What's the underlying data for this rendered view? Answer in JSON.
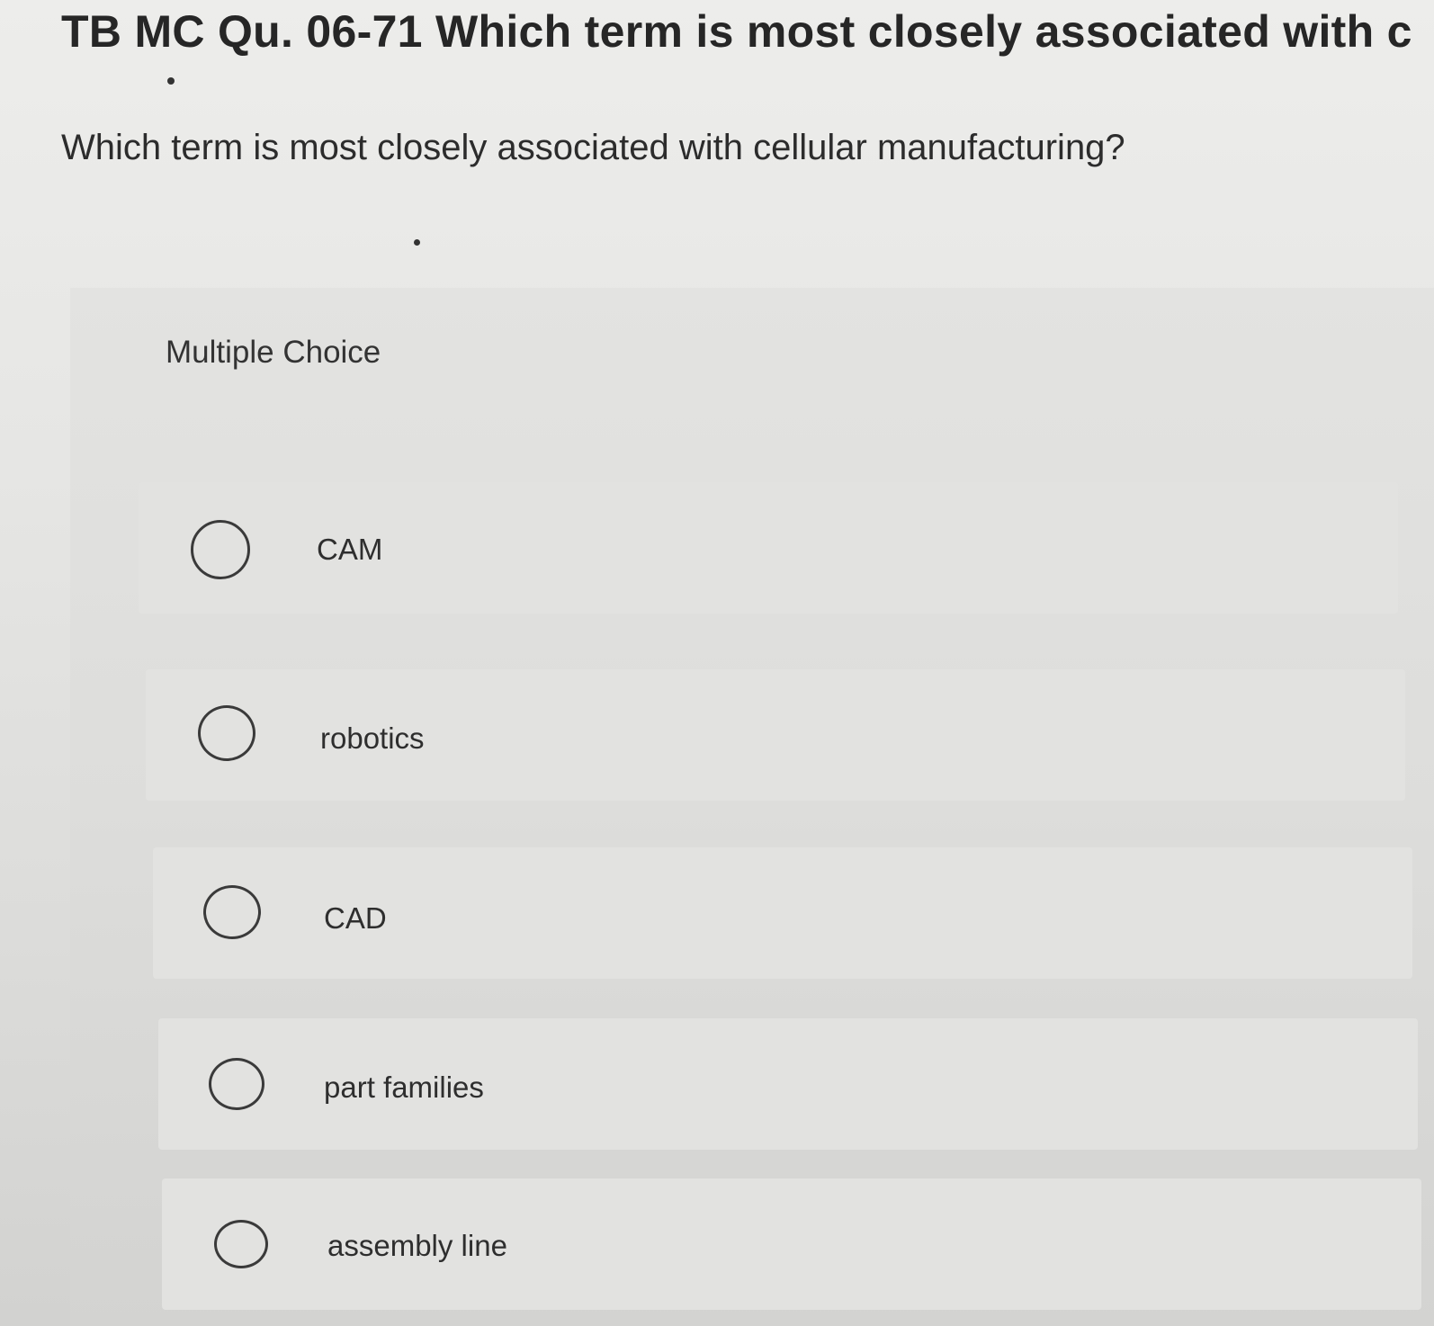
{
  "question": {
    "title": "TB MC Qu. 06-71 Which term is most closely associated with c...",
    "text": "Which term is most closely associated with cellular manufacturing?"
  },
  "answers": {
    "section_label": "Multiple Choice",
    "options": [
      {
        "label": "CAM",
        "selected": false
      },
      {
        "label": "robotics",
        "selected": false
      },
      {
        "label": "CAD",
        "selected": false
      },
      {
        "label": "part families",
        "selected": false
      },
      {
        "label": "assembly line",
        "selected": false
      }
    ]
  }
}
